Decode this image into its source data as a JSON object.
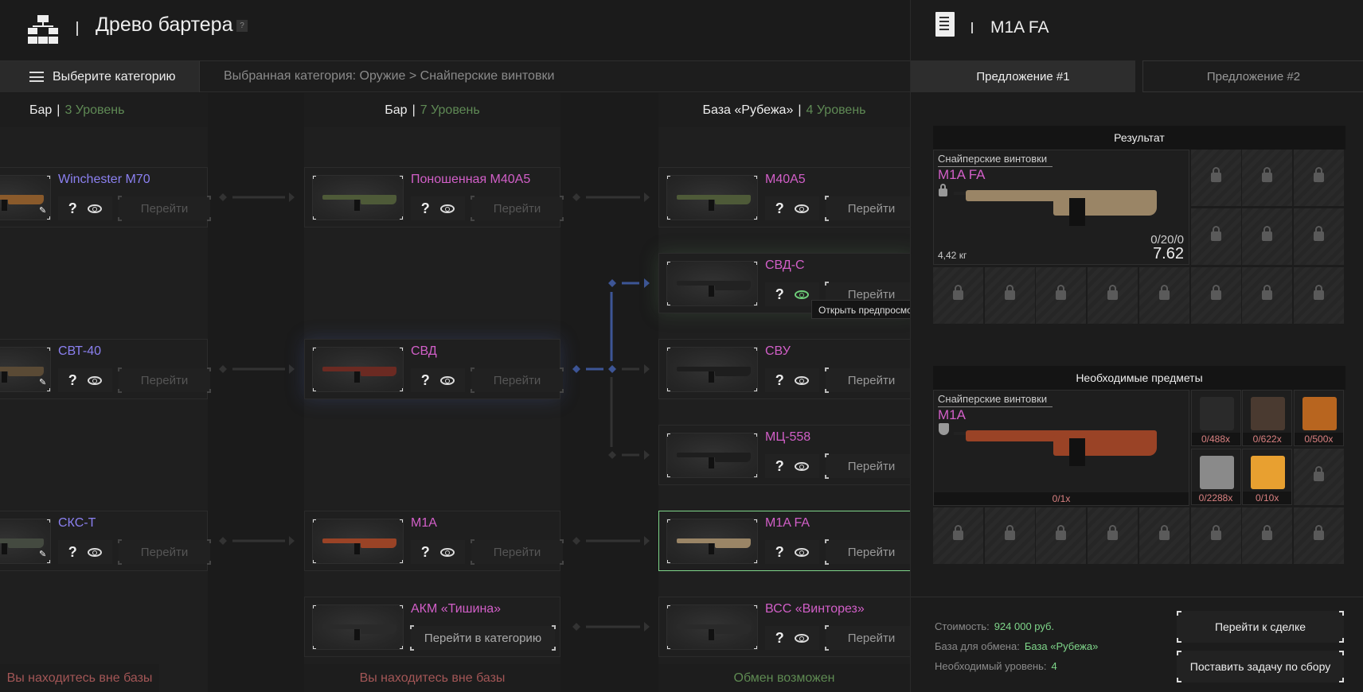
{
  "header": {
    "title": "Древо бартера",
    "help": "?"
  },
  "category_bar": {
    "button_label": "Выберите категорию",
    "selected_path": "Выбранная категория: Оружие > Снайперские винтовки"
  },
  "columns": [
    {
      "base": "Бар",
      "level": "3 Уровень",
      "status": "Вы находитесь вне базы",
      "status_color": "#a35656"
    },
    {
      "base": "Бар",
      "level": "7 Уровень",
      "status": "Вы находитесь вне базы",
      "status_color": "#a35656"
    },
    {
      "base": "База «Рубежа»",
      "level": "4 Уровень",
      "status": "Обмен возможен",
      "status_color": "#5e8a52"
    }
  ],
  "cards": [
    {
      "col": 0,
      "row": 0,
      "name": "Winchester M70",
      "color": "#8b80f0",
      "gun": "#8a5a2b",
      "button": "Перейти",
      "button_enabled": false,
      "pinned": true
    },
    {
      "col": 0,
      "row": 2,
      "name": "СВТ-40",
      "color": "#8b80f0",
      "gun": "#5a4a35",
      "button": "Перейти",
      "button_enabled": false,
      "pinned": true
    },
    {
      "col": 0,
      "row": 4,
      "name": "СКС-Т",
      "color": "#8b80f0",
      "gun": "#444a40",
      "button": "Перейти",
      "button_enabled": false,
      "pinned": true
    },
    {
      "col": 1,
      "row": 0,
      "name": "Поношенная M40A5",
      "color": "#d25fc8",
      "gun": "#4e5a38",
      "button": "Перейти",
      "button_enabled": false
    },
    {
      "col": 1,
      "row": 2,
      "name": "СВД",
      "color": "#d25fc8",
      "gun": "#6b2a22",
      "button": "Перейти",
      "button_enabled": false,
      "highlight": "blue"
    },
    {
      "col": 1,
      "row": 4,
      "name": "M1A",
      "color": "#d25fc8",
      "gun": "#9a4326",
      "button": "Перейти",
      "button_enabled": false
    },
    {
      "col": 1,
      "row": 5,
      "name": "АКМ «Тишина»",
      "color": "#d25fc8",
      "gun": "#2a2a2a",
      "button": "Перейти в категорию",
      "button_enabled": true,
      "wide": true
    },
    {
      "col": 2,
      "row": 0,
      "name": "M40A5",
      "color": "#d25fc8",
      "gun": "#4e5a38",
      "button": "Перейти",
      "button_enabled": true
    },
    {
      "col": 2,
      "row": 1,
      "name": "СВД-С",
      "color": "#d25fc8",
      "gun": "#222222",
      "button": "Перейти",
      "button_enabled": true,
      "highlight": "green",
      "eye_active": true
    },
    {
      "col": 2,
      "row": 2,
      "name": "СВУ",
      "color": "#d25fc8",
      "gun": "#1e1e1e",
      "button": "Перейти",
      "button_enabled": true
    },
    {
      "col": 2,
      "row": 3,
      "name": "МЦ-558",
      "color": "#d25fc8",
      "gun": "#1e1e1e",
      "button": "Перейти",
      "button_enabled": true
    },
    {
      "col": 2,
      "row": 4,
      "name": "M1A FA",
      "color": "#d25fc8",
      "gun": "#9a8566",
      "button": "Перейти",
      "button_enabled": true,
      "selected": true
    },
    {
      "col": 2,
      "row": 5,
      "name": "ВСС «Винторез»",
      "color": "#d25fc8",
      "gun": "#2a2a2a",
      "button": "Перейти",
      "button_enabled": true
    }
  ],
  "tooltip": "Открыть предпросмотр",
  "detail": {
    "title": "M1A FA",
    "tabs": [
      "Предложение #1",
      "Предложение #2"
    ],
    "active_tab": 0,
    "result": {
      "heading": "Результат",
      "category": "Снайперские винтовки",
      "name": "M1A FA",
      "weight": "4,42 кг",
      "ammo": "0/20/0",
      "caliber": "7.62",
      "locked": true
    },
    "required": {
      "heading": "Необходимые предметы",
      "category": "Снайперские винтовки",
      "name": "M1A",
      "count": "0/1x",
      "items": [
        {
          "count": "0/488x",
          "color": "#2a2a2a"
        },
        {
          "count": "0/622x",
          "color": "#4a3a30"
        },
        {
          "count": "0/500x",
          "color": "#b8651f"
        },
        {
          "count": "0/2288x",
          "color": "#8a8a8a"
        },
        {
          "count": "0/10x",
          "color": "#e8a030"
        }
      ]
    },
    "info": {
      "cost_label": "Стоимость:",
      "cost": "924 000 руб.",
      "base_label": "База для обмена:",
      "base": "База «Рубежа»",
      "level_label": "Необходимый уровень:",
      "level": "4"
    },
    "buttons": {
      "deal": "Перейти к сделке",
      "task": "Поставить задачу по сбору"
    }
  },
  "colors": {
    "accent_pink": "#d25fc8",
    "accent_blue": "#8b80f0",
    "positive": "#7fd68a",
    "link_active": "#3d5596"
  }
}
